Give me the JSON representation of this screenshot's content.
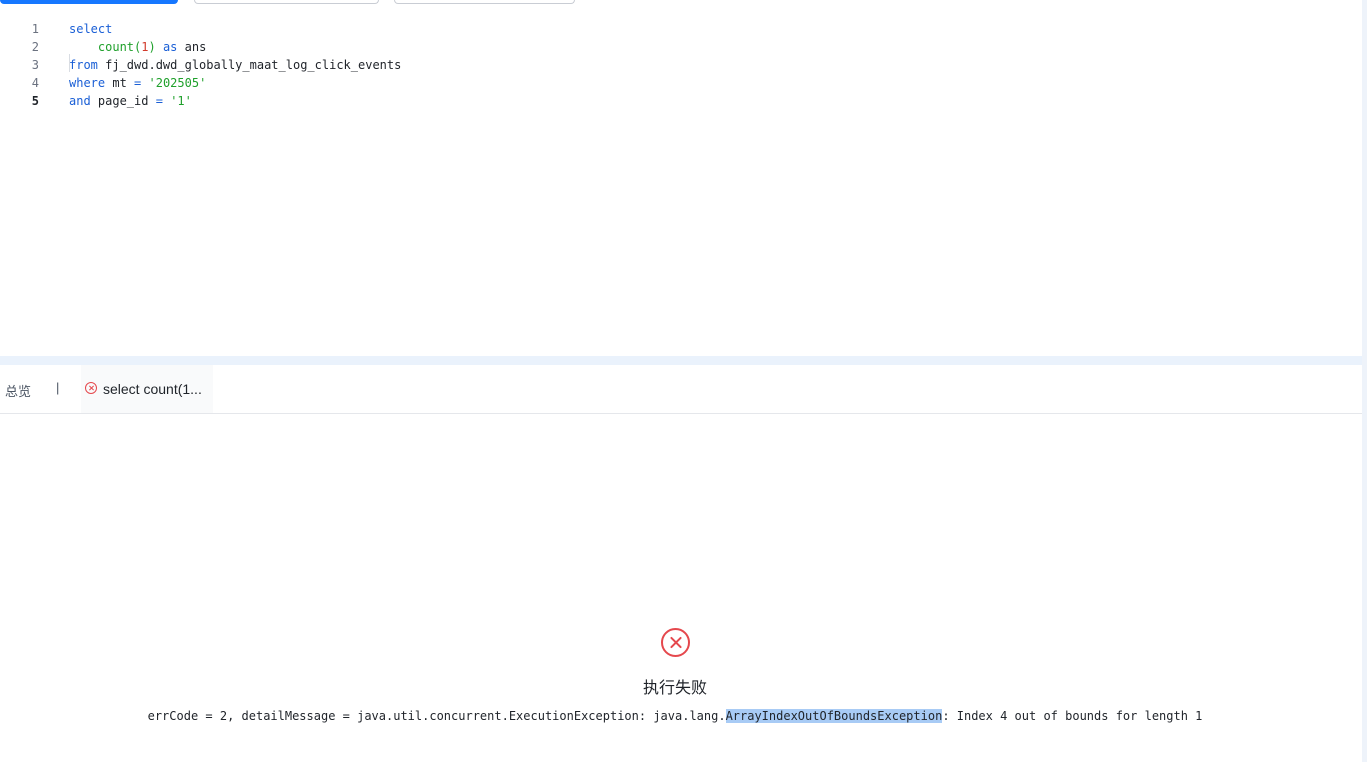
{
  "editor": {
    "lines": [
      {
        "number": "1",
        "parts": [
          {
            "t": "select",
            "c": "kw"
          }
        ]
      },
      {
        "number": "2",
        "parts": [
          {
            "t": "    ",
            "c": ""
          },
          {
            "t": "count(",
            "c": "fn"
          },
          {
            "t": "1",
            "c": "num"
          },
          {
            "t": ") ",
            "c": "fn"
          },
          {
            "t": "as",
            "c": "kw"
          },
          {
            "t": " ans",
            "c": ""
          }
        ]
      },
      {
        "number": "3",
        "parts": [
          {
            "t": "from",
            "c": "kw"
          },
          {
            "t": " fj_dwd.dwd_globally_maat_log_click_events",
            "c": ""
          }
        ]
      },
      {
        "number": "4",
        "parts": [
          {
            "t": "where",
            "c": "kw"
          },
          {
            "t": " mt ",
            "c": ""
          },
          {
            "t": "=",
            "c": "kw"
          },
          {
            "t": " ",
            "c": ""
          },
          {
            "t": "'202505'",
            "c": "str"
          }
        ]
      },
      {
        "number": "5",
        "parts": [
          {
            "t": "and",
            "c": "kw"
          },
          {
            "t": " page_id ",
            "c": ""
          },
          {
            "t": "=",
            "c": "kw"
          },
          {
            "t": " ",
            "c": ""
          },
          {
            "t": "'1'",
            "c": "str"
          }
        ]
      }
    ],
    "active_line": "5"
  },
  "results": {
    "tab_overview": "总览",
    "tab_separator": "|",
    "tab_query": "select count(1...",
    "fail_title": "执行失败",
    "error_prefix": "errCode = 2, detailMessage = java.util.concurrent.ExecutionException: java.lang.",
    "error_highlight": "ArrayIndexOutOfBoundsException",
    "error_suffix": ": Index 4 out of bounds for length 1"
  },
  "colors": {
    "primary": "#1677ff",
    "error": "#e5484d",
    "keyword": "#1a5fd6",
    "string": "#1fa02b",
    "number": "#d23a2b",
    "highlight": "#a8cbf5"
  },
  "icons": {
    "tab_status": "error-circle-icon",
    "fail_status": "error-circle-icon"
  }
}
